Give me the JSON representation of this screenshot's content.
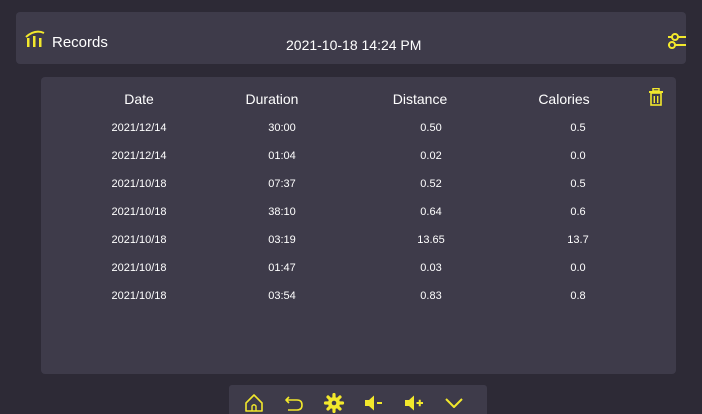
{
  "header": {
    "title": "Records",
    "datetime": "2021-10-18 14:24 PM",
    "logo_icon": "bar-chart-icon",
    "settings_icon": "sliders-icon"
  },
  "table": {
    "columns": [
      "Date",
      "Duration",
      "Distance",
      "Calories"
    ],
    "rows": [
      [
        "2021/12/14",
        "30:00",
        "0.50",
        "0.5"
      ],
      [
        "2021/12/14",
        "01:04",
        "0.02",
        "0.0"
      ],
      [
        "2021/10/18",
        "07:37",
        "0.52",
        "0.5"
      ],
      [
        "2021/10/18",
        "38:10",
        "0.64",
        "0.6"
      ],
      [
        "2021/10/18",
        "03:19",
        "13.65",
        "13.7"
      ],
      [
        "2021/10/18",
        "01:47",
        "0.03",
        "0.0"
      ],
      [
        "2021/10/18",
        "03:54",
        "0.83",
        "0.8"
      ]
    ],
    "delete_icon": "trash-icon"
  },
  "toolbar": {
    "icons": [
      "home-icon",
      "back-icon",
      "gear-icon",
      "volume-down-icon",
      "volume-up-icon",
      "chevron-down-icon"
    ]
  },
  "colors": {
    "background": "#2d2a36",
    "panel": "#3e3b4a",
    "accent": "#f2e82c",
    "text": "#ffffff"
  }
}
